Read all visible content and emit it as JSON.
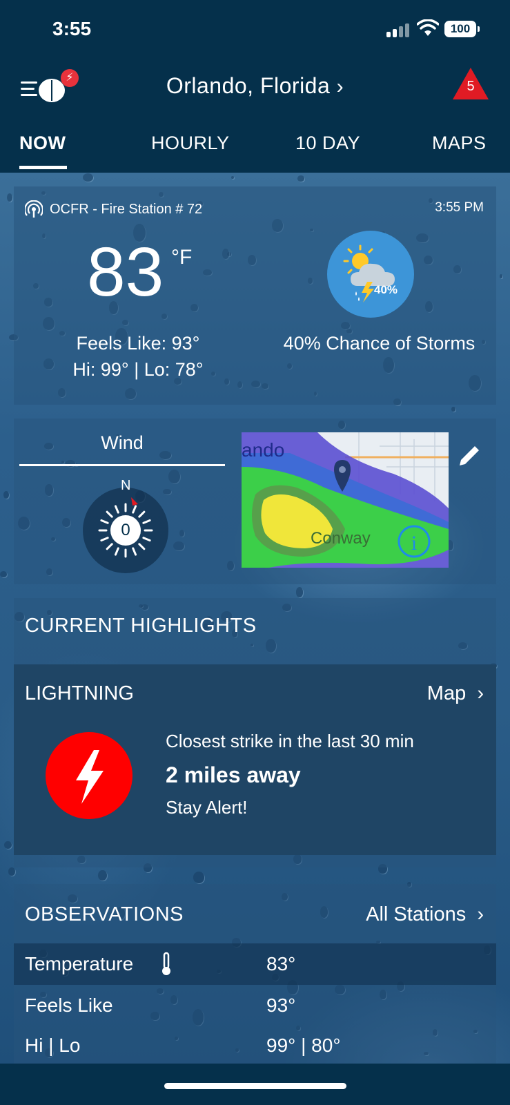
{
  "status_bar": {
    "time": "3:55",
    "battery": "100"
  },
  "header": {
    "location": "Orlando,  Florida",
    "logo_badge": "⚡",
    "alert_count": "5"
  },
  "tabs": [
    {
      "label": "NOW"
    },
    {
      "label": "HOURLY"
    },
    {
      "label": "10  DAY"
    },
    {
      "label": "MAPS"
    }
  ],
  "current": {
    "station": "OCFR - Fire Station # 72",
    "time": "3:55 PM",
    "temperature": "83",
    "unit": "°F",
    "feels_like": "Feels Like: 93°",
    "hi_lo": "Hi: 99° | Lo: 78°",
    "storm_percent": "40%",
    "storm_text": "40% Chance of Storms"
  },
  "wind": {
    "title": "Wind",
    "speed": "0",
    "direction_label": "N"
  },
  "radar_map": {
    "city_label_top": "ando",
    "city_label": "Conway"
  },
  "highlights": {
    "title": "CURRENT HIGHLIGHTS",
    "lightning": {
      "title": "LIGHTNING",
      "map_link": "Map",
      "line1": "Closest strike in the last 30 min",
      "line2": "2 miles away",
      "line3": "Stay Alert!"
    }
  },
  "observations": {
    "title": "OBSERVATIONS",
    "all_link": "All Stations",
    "rows": [
      {
        "label": "Temperature",
        "value": "83°"
      },
      {
        "label": "Feels Like",
        "value": "93°"
      },
      {
        "label": "Hi | Lo",
        "value": "99° | 80°"
      }
    ]
  },
  "colors": {
    "brand_dark": "#05304b",
    "alert_red": "#e01b24",
    "storm_blue": "#3d95d8",
    "lightning_red": "#ff0000"
  }
}
